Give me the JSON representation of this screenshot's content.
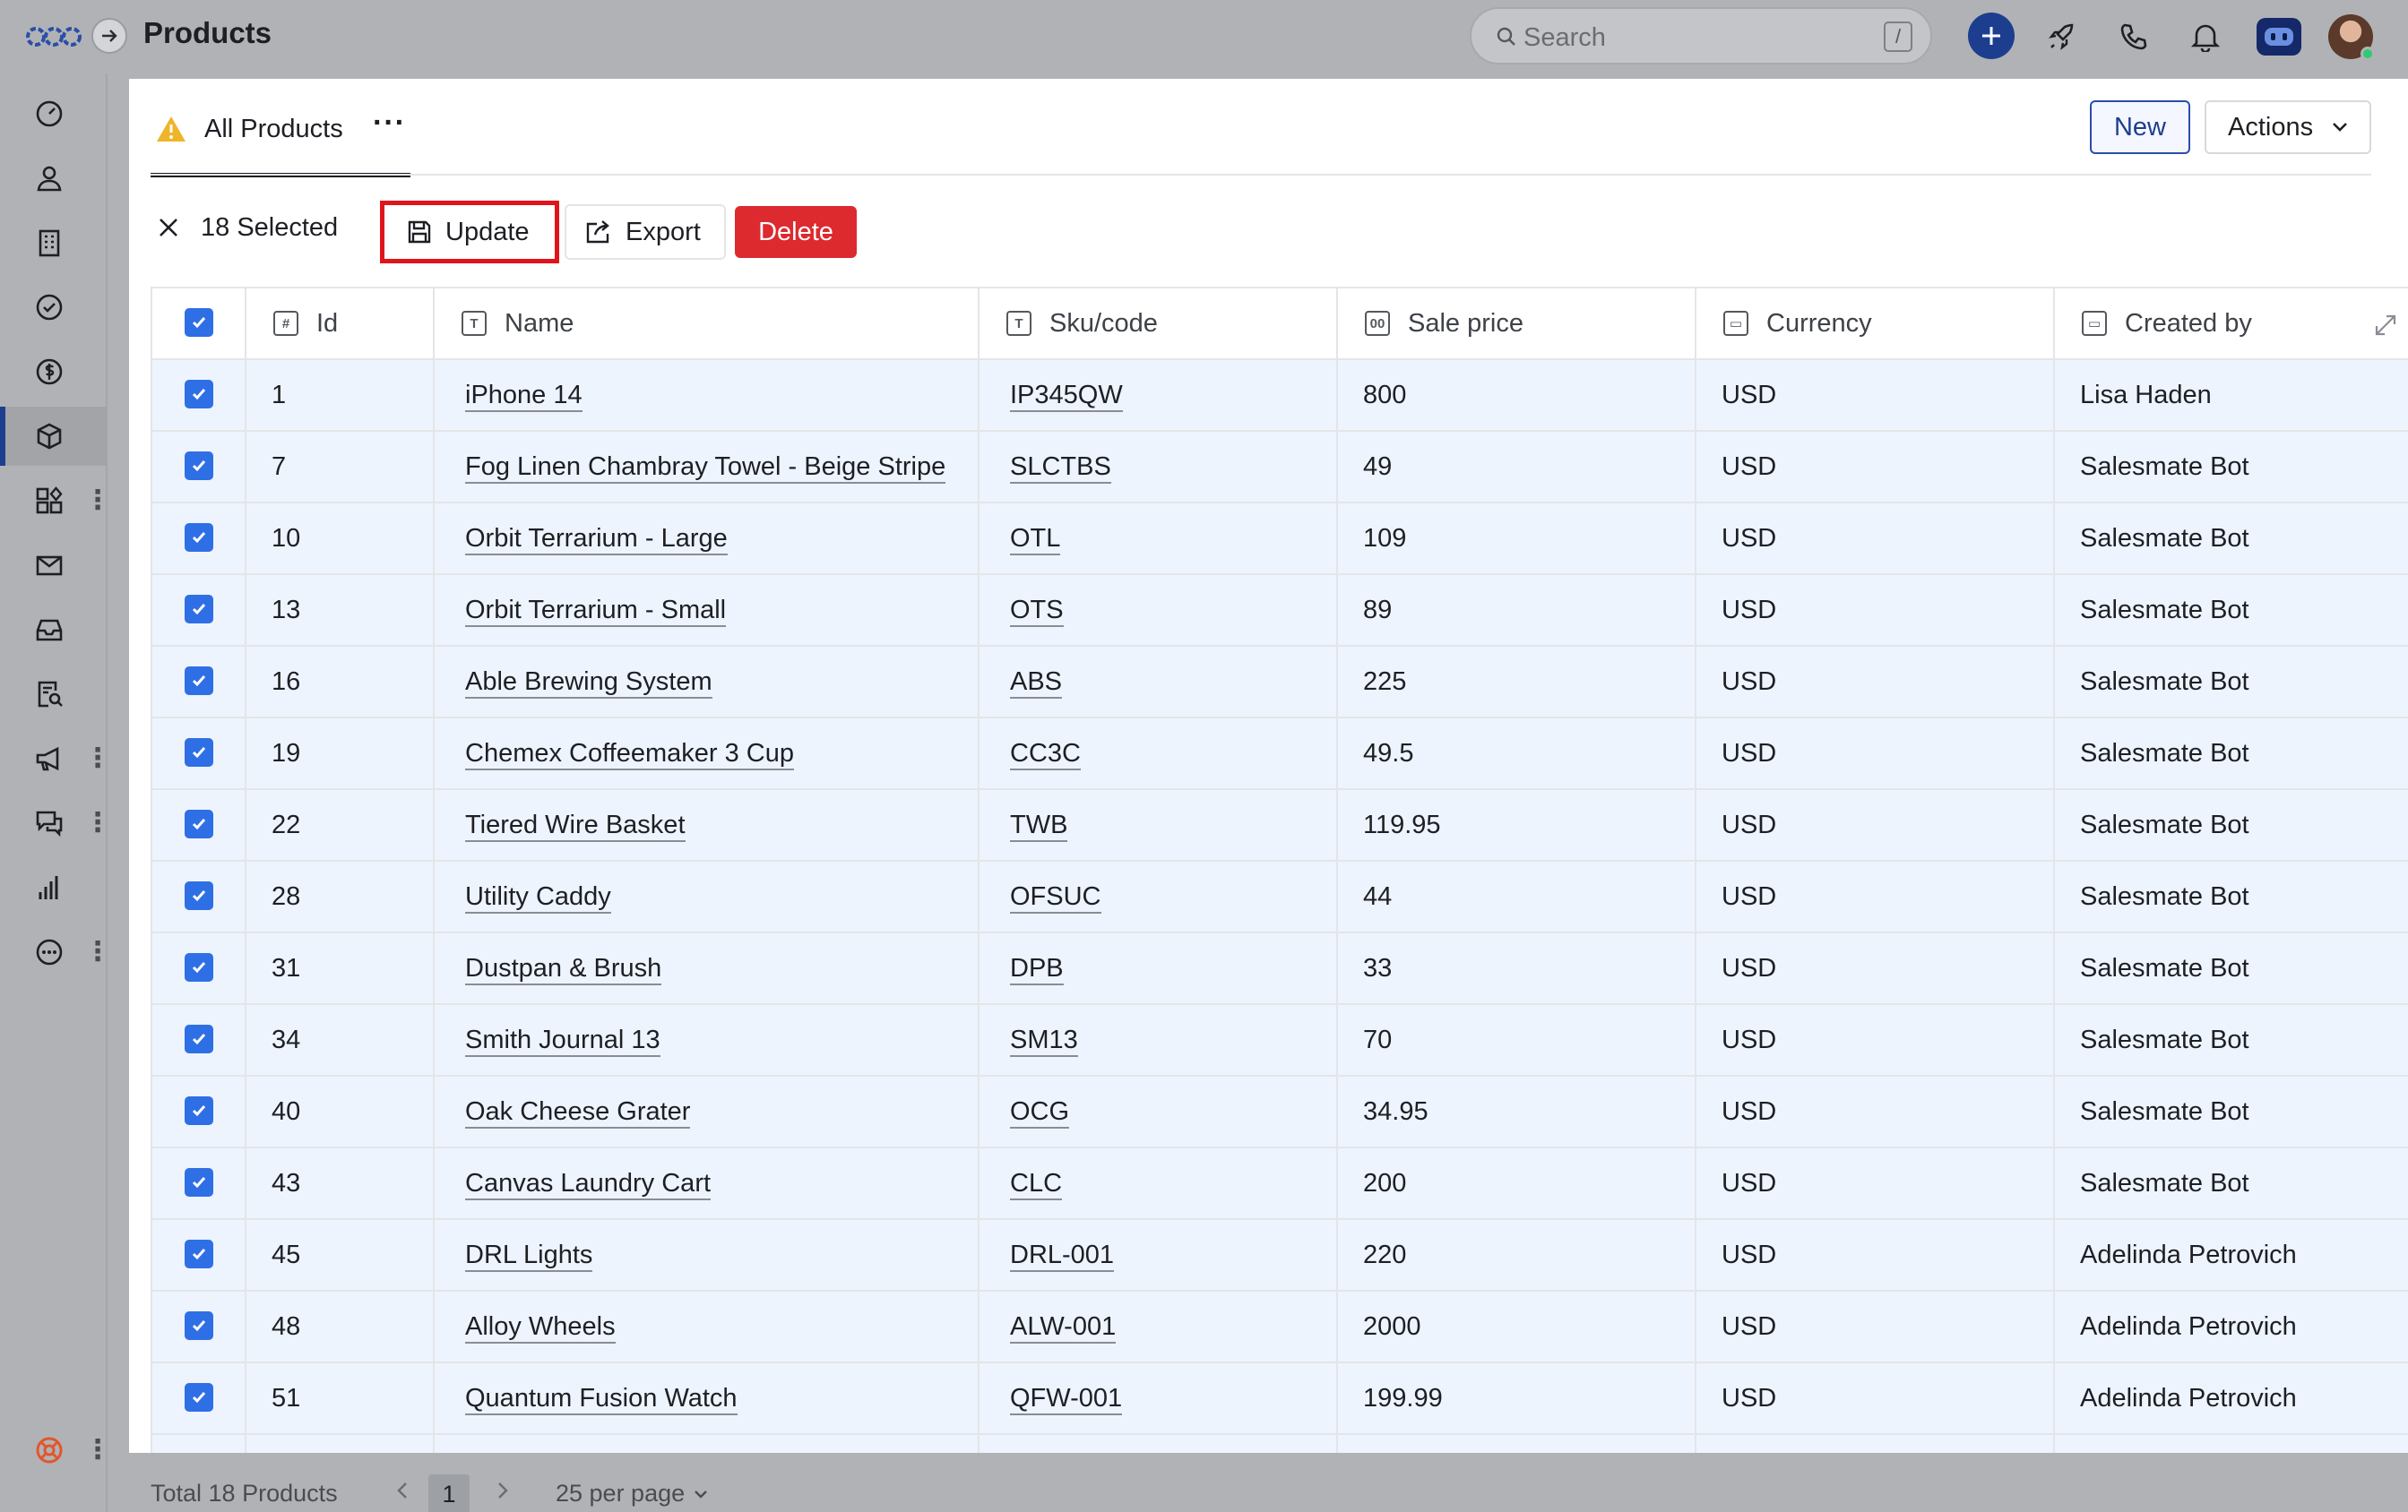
{
  "header": {
    "title": "Products",
    "search_placeholder": "Search",
    "search_shortcut": "/"
  },
  "view": {
    "name": "All Products",
    "more": "···"
  },
  "toolbar": {
    "new_label": "New",
    "actions_label": "Actions"
  },
  "selection": {
    "count_label": "18 Selected",
    "update_label": "Update",
    "export_label": "Export",
    "delete_label": "Delete"
  },
  "table": {
    "columns": [
      {
        "label": "Id",
        "icon": "#"
      },
      {
        "label": "Name",
        "icon": "T"
      },
      {
        "label": "Sku/code",
        "icon": "T"
      },
      {
        "label": "Sale price",
        "icon": "00"
      },
      {
        "label": "Currency",
        "icon": "list"
      },
      {
        "label": "Created by",
        "icon": "list"
      }
    ],
    "rows": [
      {
        "id": "1",
        "name": "iPhone 14",
        "sku": "IP345QW",
        "price": "800",
        "currency": "USD",
        "created_by": "Lisa Haden"
      },
      {
        "id": "7",
        "name": "Fog Linen Chambray Towel - Beige Stripe",
        "sku": "SLCTBS",
        "price": "49",
        "currency": "USD",
        "created_by": "Salesmate Bot"
      },
      {
        "id": "10",
        "name": "Orbit Terrarium - Large",
        "sku": "OTL",
        "price": "109",
        "currency": "USD",
        "created_by": "Salesmate Bot"
      },
      {
        "id": "13",
        "name": "Orbit Terrarium - Small",
        "sku": "OTS",
        "price": "89",
        "currency": "USD",
        "created_by": "Salesmate Bot"
      },
      {
        "id": "16",
        "name": "Able Brewing System",
        "sku": "ABS",
        "price": "225",
        "currency": "USD",
        "created_by": "Salesmate Bot"
      },
      {
        "id": "19",
        "name": "Chemex Coffeemaker 3 Cup",
        "sku": "CC3C",
        "price": "49.5",
        "currency": "USD",
        "created_by": "Salesmate Bot"
      },
      {
        "id": "22",
        "name": "Tiered Wire Basket",
        "sku": "TWB",
        "price": "119.95",
        "currency": "USD",
        "created_by": "Salesmate Bot"
      },
      {
        "id": "28",
        "name": "Utility Caddy",
        "sku": "OFSUC",
        "price": "44",
        "currency": "USD",
        "created_by": "Salesmate Bot"
      },
      {
        "id": "31",
        "name": "Dustpan & Brush",
        "sku": "DPB",
        "price": "33",
        "currency": "USD",
        "created_by": "Salesmate Bot"
      },
      {
        "id": "34",
        "name": "Smith Journal 13",
        "sku": "SM13",
        "price": "70",
        "currency": "USD",
        "created_by": "Salesmate Bot"
      },
      {
        "id": "40",
        "name": "Oak Cheese Grater",
        "sku": "OCG",
        "price": "34.95",
        "currency": "USD",
        "created_by": "Salesmate Bot"
      },
      {
        "id": "43",
        "name": "Canvas Laundry Cart",
        "sku": "CLC",
        "price": "200",
        "currency": "USD",
        "created_by": "Salesmate Bot"
      },
      {
        "id": "45",
        "name": "DRL Lights",
        "sku": "DRL-001",
        "price": "220",
        "currency": "USD",
        "created_by": "Adelinda Petrovich"
      },
      {
        "id": "48",
        "name": "Alloy Wheels",
        "sku": "ALW-001",
        "price": "2000",
        "currency": "USD",
        "created_by": "Adelinda Petrovich"
      },
      {
        "id": "51",
        "name": "Quantum Fusion Watch",
        "sku": "QFW-001",
        "price": "199.99",
        "currency": "USD",
        "created_by": "Adelinda Petrovich"
      }
    ]
  },
  "footer": {
    "total_label": "Total 18 Products",
    "current_page": "1",
    "per_page_label": "25 per page"
  },
  "colors": {
    "accent": "#1d3e8f",
    "checkbox": "#2f6fe6",
    "delete": "#dc2a2f",
    "highlight_border": "#e0141b",
    "warning": "#f0b429"
  }
}
